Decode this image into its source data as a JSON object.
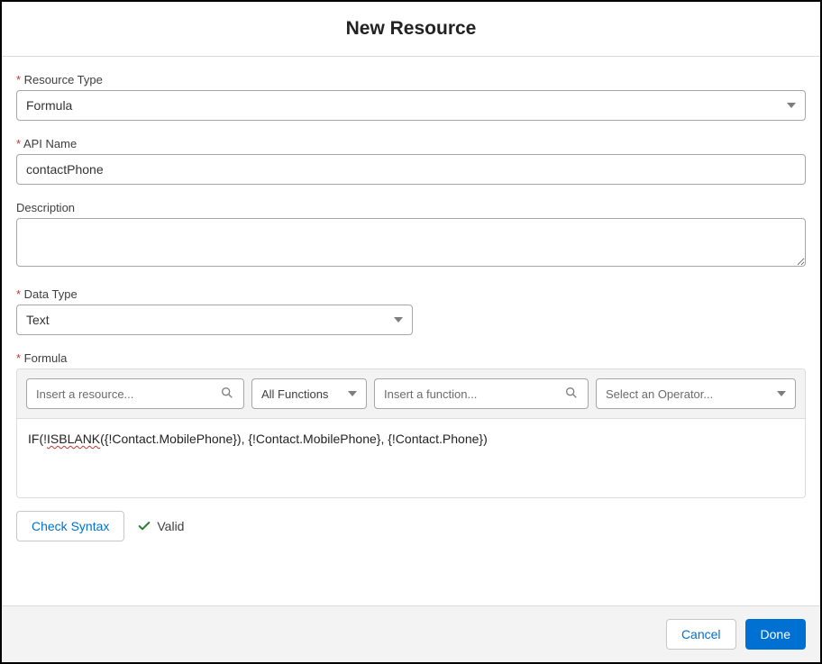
{
  "header": {
    "title": "New Resource"
  },
  "fields": {
    "resourceType": {
      "label": "Resource Type",
      "value": "Formula"
    },
    "apiName": {
      "label": "API Name",
      "value": "contactPhone"
    },
    "description": {
      "label": "Description",
      "value": ""
    },
    "dataType": {
      "label": "Data Type",
      "value": "Text"
    },
    "formula": {
      "label": "Formula",
      "toolbar": {
        "resourcePlaceholder": "Insert a resource...",
        "functionsFilter": "All Functions",
        "functionPlaceholder": "Insert a function...",
        "operatorPlaceholder": "Select an Operator..."
      },
      "prefix": "IF(!",
      "error_token": "ISBLANK",
      "suffix": "({!Contact.MobilePhone}), {!Contact.MobilePhone}, {!Contact.Phone})"
    }
  },
  "syntax": {
    "button": "Check Syntax",
    "status": "Valid"
  },
  "footer": {
    "cancel": "Cancel",
    "done": "Done"
  }
}
